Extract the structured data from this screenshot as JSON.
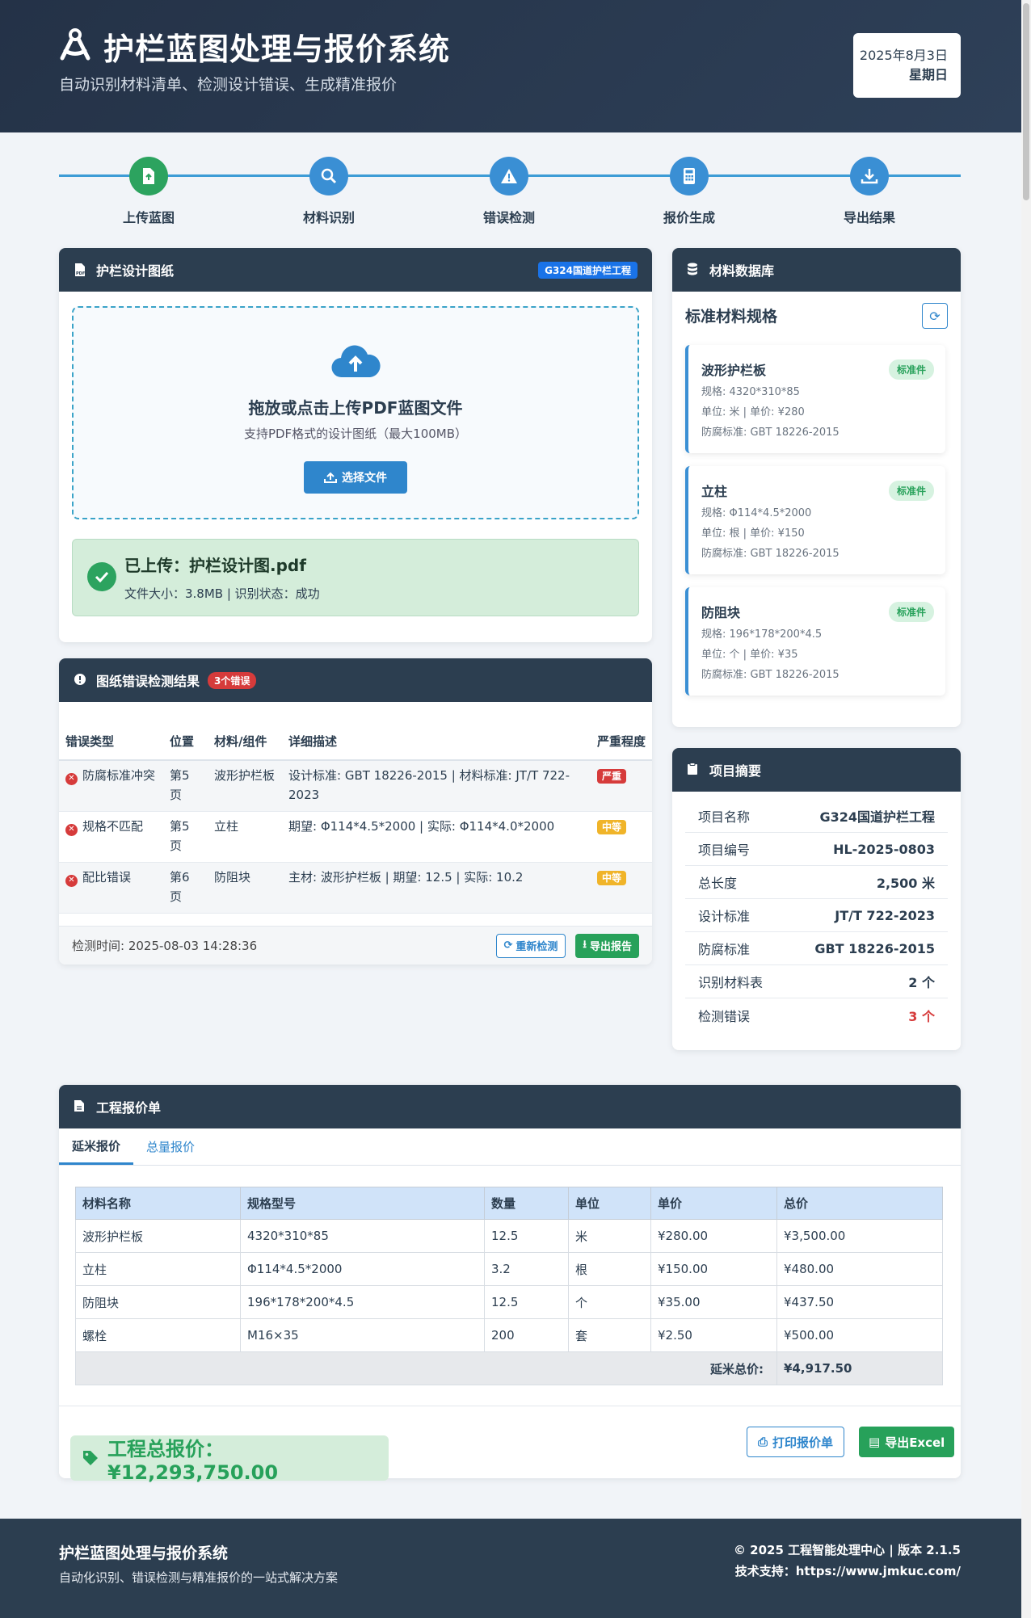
{
  "header": {
    "title": "护栏蓝图处理与报价系统",
    "subtitle": "自动识别材料清单、检测设计错误、生成精准报价",
    "date": "2025年8月3日",
    "weekday": "星期日"
  },
  "steps": [
    {
      "label": "上传蓝图",
      "icon": "file-upload-icon"
    },
    {
      "label": "材料识别",
      "icon": "search-icon"
    },
    {
      "label": "错误检测",
      "icon": "warning-icon"
    },
    {
      "label": "报价生成",
      "icon": "calculator-icon"
    },
    {
      "label": "导出结果",
      "icon": "download-icon"
    }
  ],
  "drawing_panel": {
    "title": "护栏设计图纸",
    "project_tag": "G324国道护栏工程",
    "dropzone_title": "拖放或点击上传PDF蓝图文件",
    "dropzone_hint": "支持PDF格式的设计图纸（最大100MB）",
    "choose_button": "选择文件",
    "uploaded_title": "已上传：护栏设计图.pdf",
    "uploaded_meta": "文件大小：3.8MB | 识别状态：成功"
  },
  "error_panel": {
    "title": "图纸错误检测结果",
    "count_badge": "3个错误",
    "columns": [
      "错误类型",
      "位置",
      "材料/组件",
      "详细描述",
      "严重程度"
    ],
    "rows": [
      {
        "type": "防腐标准冲突",
        "location": "第5页",
        "component": "波形护栏板",
        "detail": "设计标准: GBT 18226-2015 | 材料标准: JT/T 722-2023",
        "severity": "严重"
      },
      {
        "type": "规格不匹配",
        "location": "第5页",
        "component": "立柱",
        "detail": "期望: Φ114*4.5*2000 | 实际: Φ114*4.0*2000",
        "severity": "中等"
      },
      {
        "type": "配比错误",
        "location": "第6页",
        "component": "防阻块",
        "detail": "主材: 波形护栏板 | 期望: 12.5 | 实际: 10.2",
        "severity": "中等"
      }
    ],
    "detect_time": "检测时间: 2025-08-03 14:28:36",
    "recheck_button": "重新检测",
    "export_button": "导出报告"
  },
  "material_db": {
    "title": "材料数据库",
    "subtitle": "标准材料规格",
    "items": [
      {
        "name": "波形护栏板",
        "spec": "规格: 4320*310*85",
        "unit": "单位: 米 | 单价: ¥280",
        "standard": "防腐标准: GBT 18226-2015",
        "tag": "标准件"
      },
      {
        "name": "立柱",
        "spec": "规格: Φ114*4.5*2000",
        "unit": "单位: 根 | 单价: ¥150",
        "standard": "防腐标准: GBT 18226-2015",
        "tag": "标准件"
      },
      {
        "name": "防阻块",
        "spec": "规格: 196*178*200*4.5",
        "unit": "单位: 个 | 单价: ¥35",
        "standard": "防腐标准: GBT 18226-2015",
        "tag": "标准件"
      }
    ]
  },
  "summary": {
    "title": "项目摘要",
    "rows": [
      {
        "label": "项目名称",
        "value": "G324国道护栏工程"
      },
      {
        "label": "项目编号",
        "value": "HL-2025-0803"
      },
      {
        "label": "总长度",
        "value": "2,500 米"
      },
      {
        "label": "设计标准",
        "value": "JT/T 722-2023"
      },
      {
        "label": "防腐标准",
        "value": "GBT 18226-2015"
      },
      {
        "label": "识别材料表",
        "value": "2 个"
      },
      {
        "label": "检测错误",
        "value": "3 个"
      }
    ]
  },
  "quote": {
    "title": "工程报价单",
    "tabs": [
      "延米报价",
      "总量报价"
    ],
    "columns": [
      "材料名称",
      "规格型号",
      "数量",
      "单位",
      "单价",
      "总价"
    ],
    "rows": [
      [
        "波形护栏板",
        "4320*310*85",
        "12.5",
        "米",
        "¥280.00",
        "¥3,500.00"
      ],
      [
        "立柱",
        "Φ114*4.5*2000",
        "3.2",
        "根",
        "¥150.00",
        "¥480.00"
      ],
      [
        "防阻块",
        "196*178*200*4.5",
        "12.5",
        "个",
        "¥35.00",
        "¥437.50"
      ],
      [
        "螺栓",
        "M16×35",
        "200",
        "套",
        "¥2.50",
        "¥500.00"
      ]
    ],
    "total_label": "延米总价:",
    "total_value": "¥4,917.50",
    "grand_total": "工程总报价：¥12,293,750.00",
    "print_button": "打印报价单",
    "excel_button": "导出Excel"
  },
  "footer": {
    "title": "护栏蓝图处理与报价系统",
    "subtitle": "自动化识别、错误检测与精准报价的一站式解决方案",
    "copyright": "© 2025 工程智能处理中心 | 版本 2.1.5",
    "support": "技术支持：https://www.jmkuc.com/"
  },
  "colors": {
    "header_bg": "#2c3e50",
    "accent": "#2f86cc",
    "success": "#27a15a",
    "danger": "#d63b3b",
    "warning": "#f0b429"
  }
}
